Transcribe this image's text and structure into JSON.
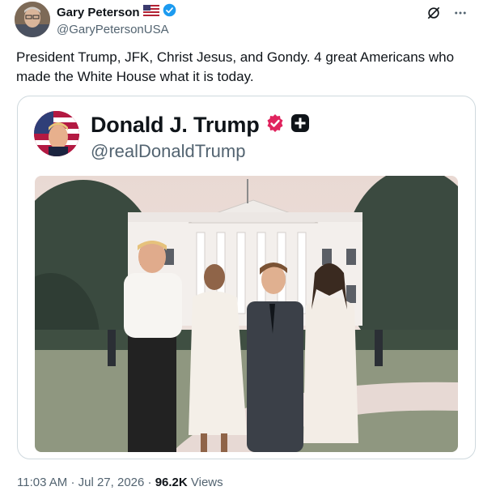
{
  "author": {
    "display_name": "Gary Peterson",
    "handle": "@GaryPetersonUSA",
    "flag_icon": "us-flag-icon",
    "verified_color": "#1d9bf0"
  },
  "tweet": {
    "text": "President Trump, JFK, Christ Jesus, and Gondy.  4 great Americans who made the White House what it is today."
  },
  "embedded_card": {
    "display_name": "Donald J. Trump",
    "handle": "@realDonaldTrump",
    "badge_color": "#e0245e"
  },
  "meta": {
    "time": "11:03 AM",
    "separator": "·",
    "date": "Jul 27, 2026",
    "views_count": "96.2K",
    "views_label": "Views"
  }
}
